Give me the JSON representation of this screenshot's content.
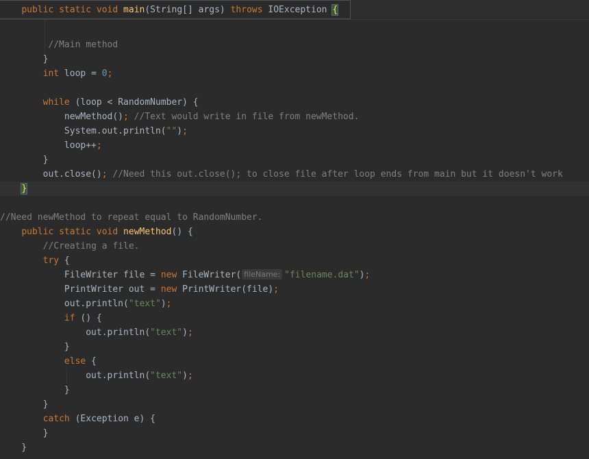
{
  "sticky_header": {
    "tokens": [
      {
        "t": "    "
      },
      {
        "t": "public",
        "c": "kw"
      },
      {
        "t": " "
      },
      {
        "t": "static",
        "c": "kw"
      },
      {
        "t": " "
      },
      {
        "t": "void",
        "c": "kw"
      },
      {
        "t": " "
      },
      {
        "t": "main",
        "c": "fn"
      },
      {
        "t": "(String[] args) "
      },
      {
        "t": "throws",
        "c": "kw"
      },
      {
        "t": " IOException "
      },
      {
        "t": "{",
        "c": "brace-hl"
      }
    ]
  },
  "code_lines": [
    {
      "tokens": []
    },
    {
      "tokens": [
        {
          "t": "         "
        },
        {
          "t": "//Main method",
          "c": "cmt"
        }
      ]
    },
    {
      "tokens": [
        {
          "t": "        }"
        }
      ]
    },
    {
      "tokens": [
        {
          "t": "        "
        },
        {
          "t": "int",
          "c": "kw"
        },
        {
          "t": " loop = "
        },
        {
          "t": "0",
          "c": "num"
        },
        {
          "t": ";",
          "c": "kw"
        }
      ]
    },
    {
      "tokens": []
    },
    {
      "tokens": [
        {
          "t": "        "
        },
        {
          "t": "while",
          "c": "kw"
        },
        {
          "t": " (loop < RandomNumber) {"
        }
      ]
    },
    {
      "tokens": [
        {
          "t": "            newMethod()"
        },
        {
          "t": ";",
          "c": "kw"
        },
        {
          "t": " "
        },
        {
          "t": "//Text would write in file from newMethod.",
          "c": "cmt"
        }
      ]
    },
    {
      "tokens": [
        {
          "t": "            System.out.println("
        },
        {
          "t": "\"\"",
          "c": "str"
        },
        {
          "t": ")"
        },
        {
          "t": ";",
          "c": "kw"
        }
      ]
    },
    {
      "tokens": [
        {
          "t": "            loop++"
        },
        {
          "t": ";",
          "c": "kw"
        }
      ]
    },
    {
      "tokens": [
        {
          "t": "        }"
        }
      ]
    },
    {
      "tokens": [
        {
          "t": "        out.close()"
        },
        {
          "t": ";",
          "c": "kw"
        },
        {
          "t": " "
        },
        {
          "t": "//Need this out.close(); to close file after loop ends from main but it doesn't work",
          "c": "cmt"
        }
      ]
    },
    {
      "tokens": [
        {
          "t": "    "
        },
        {
          "t": "}",
          "c": "brace-hl"
        }
      ],
      "current": true
    },
    {
      "tokens": []
    },
    {
      "tokens": [
        {
          "t": "//Need newMethod to repeat equal to RandomNumber.",
          "c": "cmt"
        }
      ]
    },
    {
      "tokens": [
        {
          "t": "    "
        },
        {
          "t": "public",
          "c": "kw"
        },
        {
          "t": " "
        },
        {
          "t": "static",
          "c": "kw"
        },
        {
          "t": " "
        },
        {
          "t": "void",
          "c": "kw"
        },
        {
          "t": " "
        },
        {
          "t": "newMethod",
          "c": "fn"
        },
        {
          "t": "() {"
        }
      ]
    },
    {
      "tokens": [
        {
          "t": "        "
        },
        {
          "t": "//Creating a file.",
          "c": "cmt"
        }
      ]
    },
    {
      "tokens": [
        {
          "t": "        "
        },
        {
          "t": "try",
          "c": "kw"
        },
        {
          "t": " {"
        }
      ]
    },
    {
      "tokens": [
        {
          "t": "            FileWriter file = "
        },
        {
          "t": "new",
          "c": "kw"
        },
        {
          "t": " FileWriter("
        },
        {
          "t": "fileName:",
          "c": "hint"
        },
        {
          "t": "\"filename.dat\"",
          "c": "str"
        },
        {
          "t": ")"
        },
        {
          "t": ";",
          "c": "kw"
        }
      ]
    },
    {
      "tokens": [
        {
          "t": "            PrintWriter out = "
        },
        {
          "t": "new",
          "c": "kw"
        },
        {
          "t": " PrintWriter(file)"
        },
        {
          "t": ";",
          "c": "kw"
        }
      ]
    },
    {
      "tokens": [
        {
          "t": "            out.println("
        },
        {
          "t": "\"text\"",
          "c": "str"
        },
        {
          "t": ")"
        },
        {
          "t": ";",
          "c": "kw"
        }
      ]
    },
    {
      "tokens": [
        {
          "t": "            "
        },
        {
          "t": "if",
          "c": "kw"
        },
        {
          "t": " () {"
        }
      ]
    },
    {
      "tokens": [
        {
          "t": "                out.println("
        },
        {
          "t": "\"text\"",
          "c": "str"
        },
        {
          "t": ")"
        },
        {
          "t": ";",
          "c": "kw"
        }
      ]
    },
    {
      "tokens": [
        {
          "t": "            }"
        }
      ]
    },
    {
      "tokens": [
        {
          "t": "            "
        },
        {
          "t": "else",
          "c": "kw"
        },
        {
          "t": " {"
        }
      ]
    },
    {
      "tokens": [
        {
          "t": "                out.println("
        },
        {
          "t": "\"text\"",
          "c": "str"
        },
        {
          "t": ")"
        },
        {
          "t": ";",
          "c": "kw"
        }
      ]
    },
    {
      "tokens": [
        {
          "t": "            }"
        }
      ]
    },
    {
      "tokens": [
        {
          "t": "        }"
        }
      ]
    },
    {
      "tokens": [
        {
          "t": "        "
        },
        {
          "t": "catch",
          "c": "kw"
        },
        {
          "t": " (Exception e) {"
        }
      ]
    },
    {
      "tokens": [
        {
          "t": "        }"
        }
      ]
    },
    {
      "tokens": [
        {
          "t": "    }"
        }
      ]
    }
  ],
  "colors": {
    "background": "#2b2b2b",
    "keyword": "#cc7832",
    "method": "#ffc66d",
    "comment": "#808080",
    "number": "#6897bb",
    "string": "#6a8759",
    "brace_match": "#ffef28"
  }
}
